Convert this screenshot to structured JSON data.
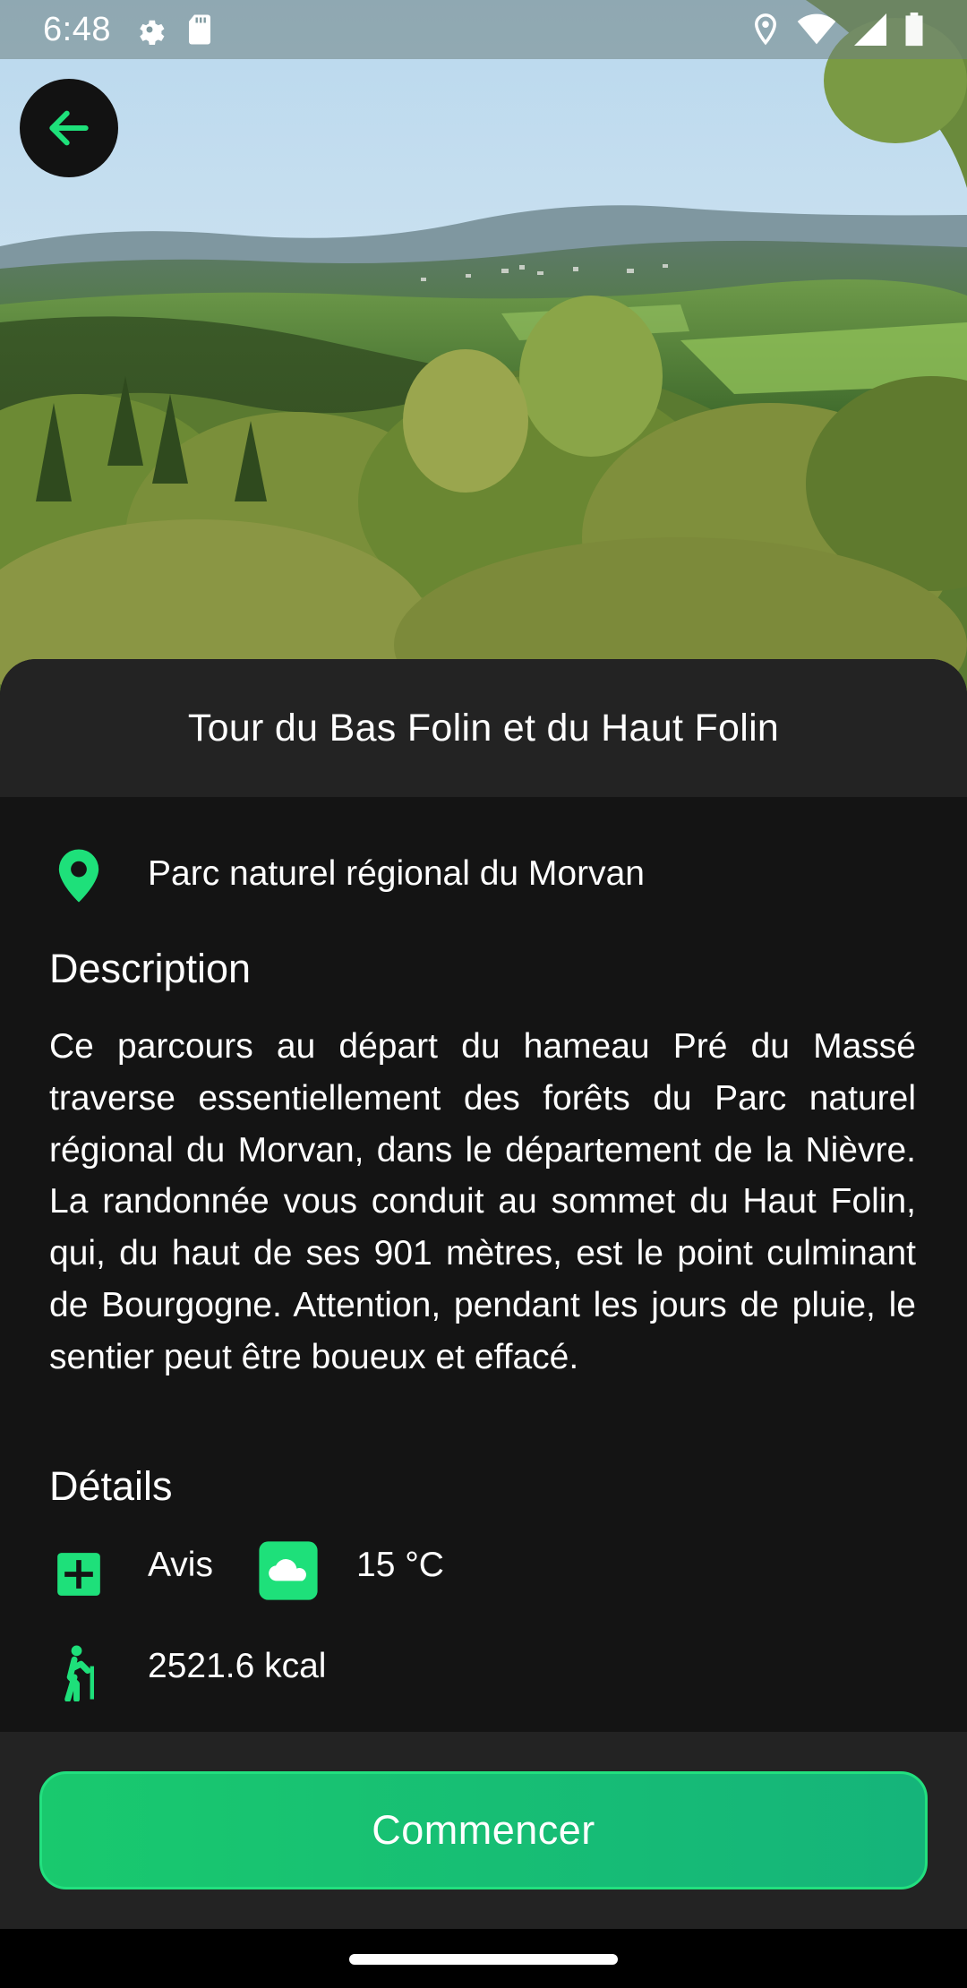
{
  "status_bar": {
    "time": "6:48",
    "left_icons": [
      "settings-icon",
      "sd-card-icon"
    ],
    "right_icons": [
      "location-icon",
      "wifi-icon",
      "signal-icon",
      "battery-icon"
    ]
  },
  "hero": {
    "image": "landscape-photo",
    "back_icon": "arrow-back-icon"
  },
  "trail": {
    "title": "Tour du Bas Folin et du Haut Folin",
    "location": "Parc naturel régional du Morvan",
    "description_heading": "Description",
    "description": "Ce parcours au départ du hameau Pré du Massé traverse essentiellement des forêts du Parc naturel régional du Morvan, dans le département de la Nièvre. La randonnée vous conduit au sommet du Haut Folin, qui, du haut de ses 901 mètres, est le point culminant de Bourgogne. Attention, pendant les jours de pluie, le sentier peut être boueux et effacé.",
    "details_heading": "Détails",
    "details": {
      "review_label": "Avis",
      "temperature": "15 °C",
      "calories": "2521.6 kcal"
    }
  },
  "actions": {
    "start_label": "Commencer"
  },
  "colors": {
    "accent": "#1ee07a",
    "background": "#141414",
    "surface": "#232323"
  }
}
